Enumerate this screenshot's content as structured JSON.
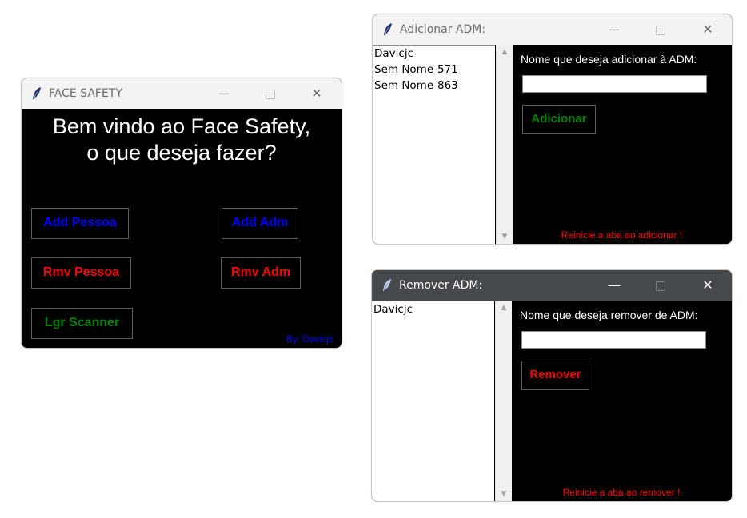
{
  "main_window": {
    "title": "FACE SAFETY",
    "welcome_line1": "Bem vindo ao Face Safety,",
    "welcome_line2": "o que deseja fazer?",
    "buttons": {
      "add_pessoa": "Add Pessoa",
      "add_adm": "Add Adm",
      "rmv_pessoa": "Rmv Pessoa",
      "rmv_adm": "Rmv Adm",
      "lgr_scanner": "Lgr Scanner"
    },
    "credit": "By: Davicjc"
  },
  "add_window": {
    "title": "Adicionar ADM:",
    "list": [
      "Davicjc",
      "Sem Nome-571",
      "Sem Nome-863"
    ],
    "prompt": "Nome que deseja adicionar à ADM:",
    "input_value": "",
    "button": "Adicionar",
    "note": "Reinicie a aba ao adicionar !"
  },
  "remove_window": {
    "title": "Remover ADM:",
    "list": [
      "Davicjc"
    ],
    "prompt": "Nome que deseja remover de ADM:",
    "input_value": "",
    "button": "Remover",
    "note": "Reinicie a aba ao remover !"
  },
  "titlebar_controls": {
    "minimize": "—",
    "close": "✕"
  },
  "colors": {
    "blue_text": "#0000ff",
    "red_text": "#ff0000",
    "green_text": "#008000",
    "app_background": "#000000",
    "active_titlebar": "#45494c",
    "inactive_titlebar": "#f3f3f3"
  }
}
